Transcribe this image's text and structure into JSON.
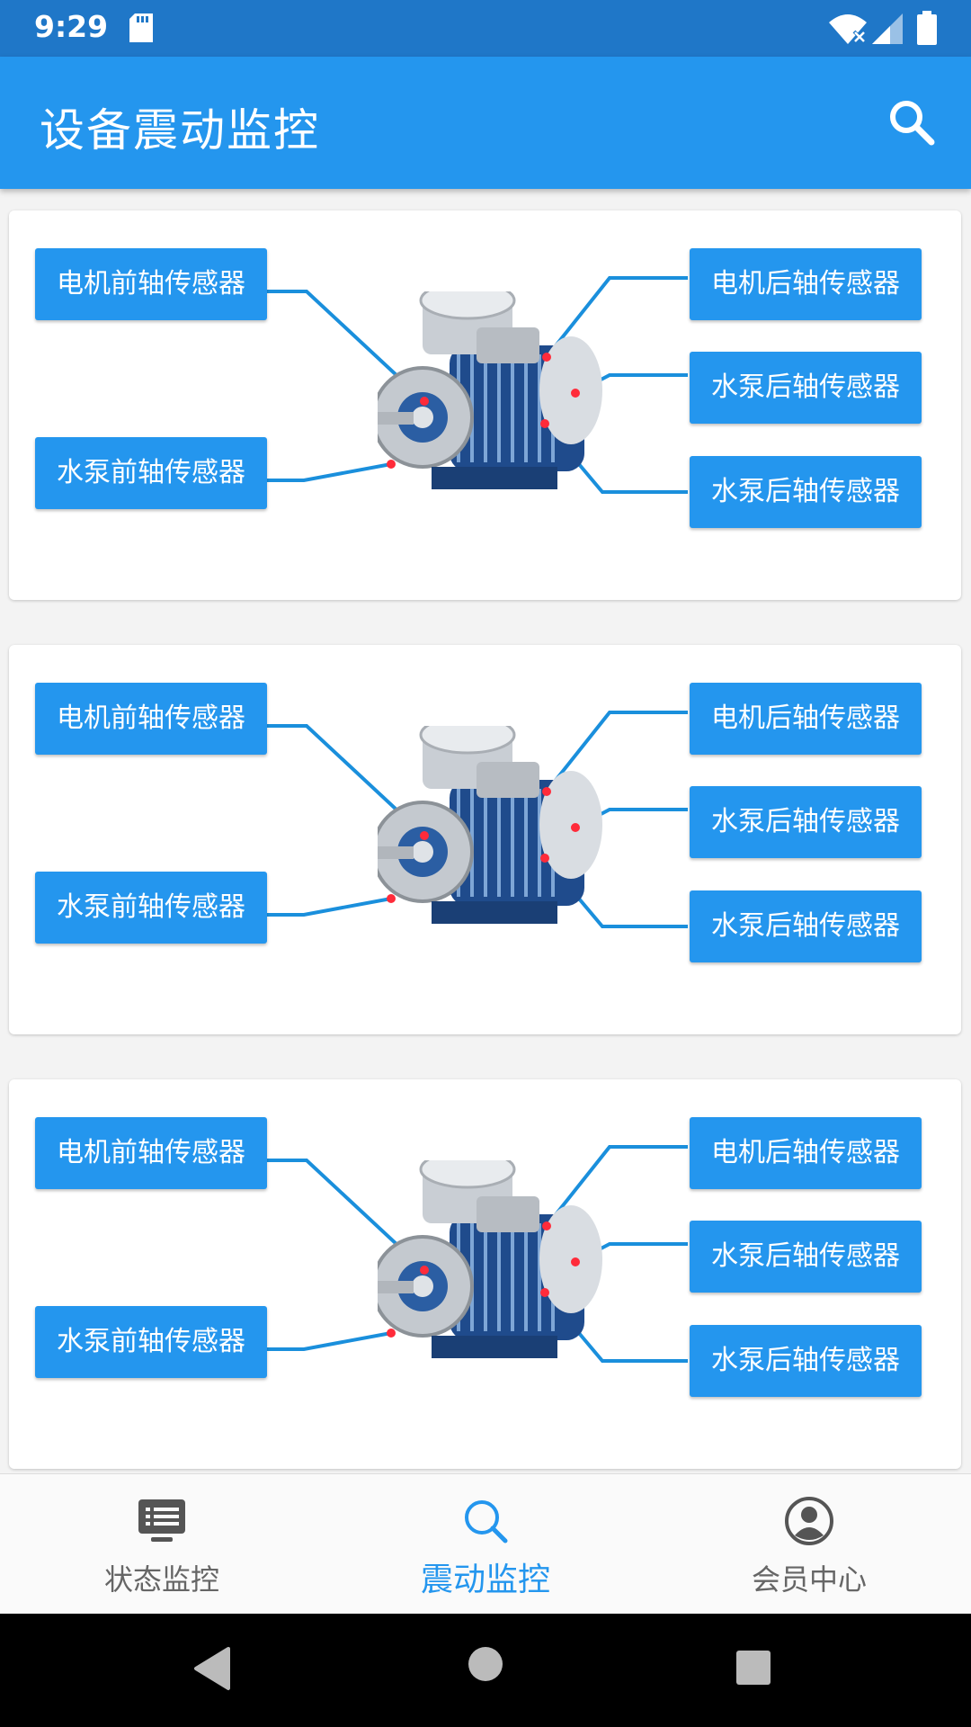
{
  "status_bar": {
    "time": "9:29"
  },
  "app_bar": {
    "title": "设备震动监控"
  },
  "cards": [
    {
      "labels": {
        "motor_front": "电机前轴传感器",
        "pump_front": "水泵前轴传感器",
        "motor_rear": "电机后轴传感器",
        "pump_rear_1": "水泵后轴传感器",
        "pump_rear_2": "水泵后轴传感器"
      }
    },
    {
      "labels": {
        "motor_front": "电机前轴传感器",
        "pump_front": "水泵前轴传感器",
        "motor_rear": "电机后轴传感器",
        "pump_rear_1": "水泵后轴传感器",
        "pump_rear_2": "水泵后轴传感器"
      }
    },
    {
      "labels": {
        "motor_front": "电机前轴传感器",
        "pump_front": "水泵前轴传感器",
        "motor_rear": "电机后轴传感器",
        "pump_rear_1": "水泵后轴传感器",
        "pump_rear_2": "水泵后轴传感器"
      }
    }
  ],
  "bottom_nav": {
    "items": [
      {
        "label": "状态监控",
        "icon": "monitor-icon",
        "active": false
      },
      {
        "label": "震动监控",
        "icon": "search-icon",
        "active": true
      },
      {
        "label": "会员中心",
        "icon": "user-icon",
        "active": false
      }
    ]
  },
  "colors": {
    "primary": "#2496ee",
    "status_bar": "#1f77c8",
    "line": "#1a8fdc",
    "sensor_dot": "#ff2b3a"
  }
}
